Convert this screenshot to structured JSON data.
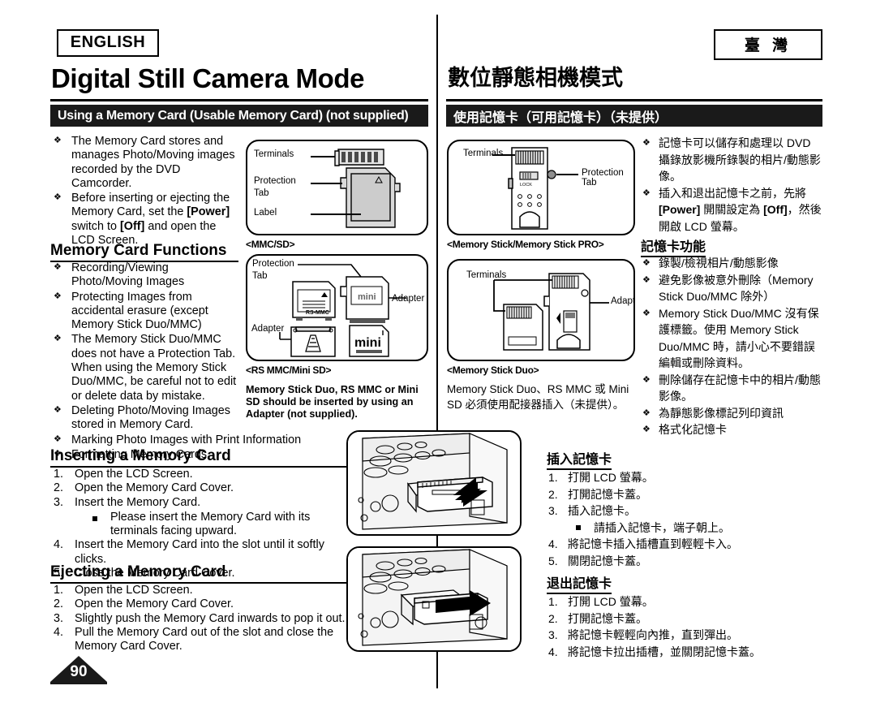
{
  "header": {
    "lang_en": "ENGLISH",
    "lang_tw": "臺 灣",
    "title_en": "Digital Still Camera Mode",
    "title_tw": "數位靜態相機模式",
    "section_en": "Using a Memory Card (Usable Memory Card) (not supplied)",
    "section_tw": "使用記憶卡（可用記憶卡）（未提供）"
  },
  "english": {
    "intro_bullets": [
      "The Memory Card stores and manages Photo/Moving images recorded by the DVD Camcorder.",
      "Before inserting or ejecting the Memory Card, set the [Power] switch to [Off] and open the LCD Screen."
    ],
    "functions_heading": "Memory Card Functions",
    "function_bullets": [
      "Recording/Viewing Photo/Moving Images",
      "Protecting Images from accidental erasure (except Memory Stick Duo/MMC)",
      "The Memory Stick Duo/MMC does not have a Protection Tab. When using the Memory Stick Duo/MMC, be careful not to edit or delete data by mistake.",
      "Deleting Photo/Moving Images stored in Memory Card.",
      "Marking Photo Images with Print Information",
      "Formatting Memory Cards"
    ],
    "inserting_heading": "Inserting a Memory Card",
    "inserting_steps": [
      "Open the LCD Screen.",
      "Open the Memory Card Cover.",
      "Insert the Memory Card.",
      "Insert the Memory Card into the slot until it softly clicks.",
      "Close the Memory Card Cover."
    ],
    "inserting_substep": "Please insert the Memory Card with its terminals facing upward.",
    "ejecting_heading": "Ejecting a Memory Card",
    "ejecting_steps": [
      "Open the LCD Screen.",
      "Open the Memory Card Cover.",
      "Slightly push the Memory Card inwards to pop it out.",
      "Pull the Memory Card out of the slot and close the Memory Card Cover."
    ],
    "adapter_note": "Memory Stick Duo, RS MMC or Mini SD should be inserted by using an Adapter (not supplied)."
  },
  "chinese": {
    "intro_bullets": [
      "記憶卡可以儲存和處理以 DVD 攝錄放影機所錄製的相片/動態影像。",
      "插入和退出記憶卡之前，先將 [Power] 開關設定為 [Off]，然後開啟 LCD 螢幕。"
    ],
    "functions_heading": "記憶卡功能",
    "function_bullets": [
      "錄製/檢視相片/動態影像",
      "避免影像被意外刪除（Memory Stick Duo/MMC 除外）",
      "Memory Stick Duo/MMC 沒有保護標籤。使用 Memory Stick Duo/MMC 時，請小心不要錯誤編輯或刪除資料。",
      "刪除儲存在記憶卡中的相片/動態影像。",
      "為靜態影像標記列印資訊",
      "格式化記憶卡"
    ],
    "inserting_heading": "插入記憶卡",
    "inserting_steps": [
      "打開 LCD 螢幕。",
      "打開記憶卡蓋。",
      "插入記憶卡。",
      "將記憶卡插入插槽直到輕輕卡入。",
      "關閉記憶卡蓋。"
    ],
    "inserting_substep": "請插入記憶卡，端子朝上。",
    "ejecting_heading": "退出記憶卡",
    "ejecting_steps": [
      "打開 LCD 螢幕。",
      "打開記憶卡蓋。",
      "將記憶卡輕輕向內推，直到彈出。",
      "將記憶卡拉出插槽，並關閉記憶卡蓋。"
    ],
    "adapter_note": "Memory Stick Duo、RS MMC 或 Mini SD 必須使用配接器插入（未提供）。"
  },
  "figures": {
    "mmc_sd": {
      "caption": "<MMC/SD>",
      "labels": {
        "terminals": "Terminals",
        "protection_tab_l1": "Protection",
        "protection_tab_l2": "Tab",
        "label": "Label"
      }
    },
    "memory_stick": {
      "caption": "<Memory Stick/Memory Stick PRO>",
      "labels": {
        "terminals": "Terminals",
        "protection_tab": "Protection Tab",
        "lock": "LOCK"
      }
    },
    "rs_mmc_mini_sd": {
      "caption": "<RS MMC/Mini SD>",
      "labels": {
        "protection_tab_l1": "Protection",
        "protection_tab_l2": "Tab",
        "adapter_right": "Adapter",
        "adapter_left": "Adapter",
        "rs_mmc": "RS-MMC",
        "mini_small": "mini",
        "mini_big": "mini"
      }
    },
    "memory_stick_duo": {
      "caption": "<Memory Stick Duo>",
      "labels": {
        "terminals": "Terminals",
        "adapter": "Adapter"
      }
    }
  },
  "page_number": "90"
}
